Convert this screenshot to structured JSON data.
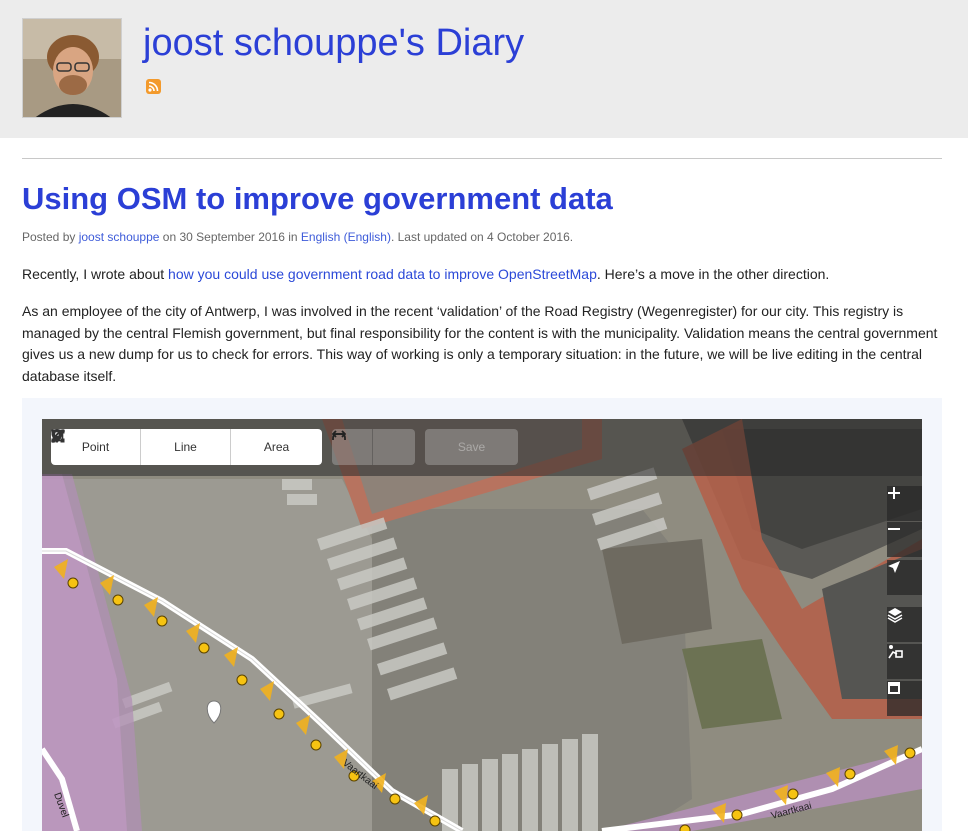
{
  "header": {
    "title": "joost schouppe's Diary",
    "avatar_alt": "avatar",
    "rss_icon": "rss-icon"
  },
  "post": {
    "title": "Using OSM to improve government data",
    "meta": {
      "posted_by": "Posted by",
      "author": "joost schouppe",
      "on_date": "on 30 September 2016 in",
      "language": "English (English)",
      "updated": ". Last updated on 4 October 2016."
    },
    "para1": {
      "before": "Recently, I wrote about ",
      "link": "how you could use government road data to improve OpenStreetMap",
      "after": ". Here’s a move in the other direction."
    },
    "para2": "As an employee of the city of Antwerp, I was involved in the recent ‘validation’ of the Road Registry (Wegenregister) for our city. This registry is managed by the central Flemish government, but final responsibility for the content is with the municipality. Validation means the central government gives us a new dump for us to check for errors. This way of working is only a temporary situation: in the future, we will be live editing in the central database itself."
  },
  "editor": {
    "tools": [
      {
        "label": "Point",
        "icon": "point-icon"
      },
      {
        "label": "Line",
        "icon": "line-icon"
      },
      {
        "label": "Area",
        "icon": "area-icon"
      }
    ],
    "undo_icon": "undo-icon",
    "redo_icon": "redo-icon",
    "save_label": "Save",
    "controls": [
      "zoom-in-icon",
      "zoom-out-icon",
      "geolocate-icon",
      "layers-icon",
      "map-data-icon",
      "issues-icon"
    ],
    "street_labels": [
      "Vaartkaai",
      "Vaartkaai",
      "Duvel"
    ]
  }
}
